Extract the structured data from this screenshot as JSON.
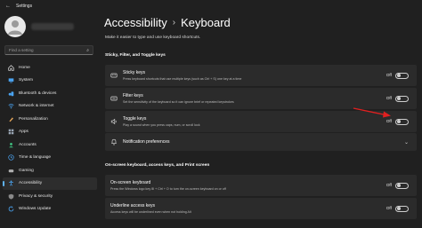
{
  "titlebar": {
    "title": "Settings",
    "back_icon": "back-arrow-icon"
  },
  "search": {
    "placeholder": "Find a setting"
  },
  "sidebar": {
    "items": [
      {
        "label": "Home",
        "icon": "home-icon",
        "color": "#e6e6e6"
      },
      {
        "label": "System",
        "icon": "system-icon",
        "color": "#4aa3f0"
      },
      {
        "label": "Bluetooth & devices",
        "icon": "bluetooth-icon",
        "color": "#4aa3f0"
      },
      {
        "label": "Network & internet",
        "icon": "network-icon",
        "color": "#4aa3f0"
      },
      {
        "label": "Personalization",
        "icon": "brush-icon",
        "color": "#e6a65a"
      },
      {
        "label": "Apps",
        "icon": "apps-icon",
        "color": "#9aa6b5"
      },
      {
        "label": "Accounts",
        "icon": "accounts-icon",
        "color": "#3fbf7f"
      },
      {
        "label": "Time & language",
        "icon": "time-language-icon",
        "color": "#4aa3f0"
      },
      {
        "label": "Gaming",
        "icon": "gaming-icon",
        "color": "#b0b0b0"
      },
      {
        "label": "Accessibility",
        "icon": "accessibility-icon",
        "color": "#4aa3f0",
        "active": true
      },
      {
        "label": "Privacy & security",
        "icon": "shield-icon",
        "color": "#8a8a8a"
      },
      {
        "label": "Windows Update",
        "icon": "windows-update-icon",
        "color": "#4aa3f0"
      }
    ]
  },
  "main": {
    "breadcrumb_parent": "Accessibility",
    "breadcrumb_current": "Keyboard",
    "subtitle": "Make it easier to type and use keyboard shortcuts.",
    "section1": "Sticky, Filter, and Toggle keys",
    "section2": "On-screen keyboard, access keys, and Print screen",
    "cards": [
      {
        "title": "Sticky keys",
        "desc": "Press keyboard shortcuts that use multiple keys (such as Ctrl + S) one key at a time",
        "state": "Off",
        "icon": "sticky-keys-icon"
      },
      {
        "title": "Filter keys",
        "desc": "Set the sensitivity of the keyboard so it can ignore brief or repeated keystrokes",
        "state": "Off",
        "icon": "filter-keys-icon"
      },
      {
        "title": "Toggle keys",
        "desc": "Play a sound when you press caps, num, or scroll lock",
        "state": "Off",
        "icon": "speaker-icon"
      },
      {
        "title": "Notification preferences",
        "icon": "bell-icon"
      },
      {
        "title": "On-screen keyboard",
        "desc": "Press the Windows logo key ⊞ + Ctrl + O to turn the on-screen keyboard on or off",
        "state": "Off",
        "icon": "keyboard-icon"
      },
      {
        "title": "Underline access keys",
        "desc": "Access keys will be underlined even when not holding Alt",
        "state": "Off",
        "icon": "underline-icon"
      }
    ]
  },
  "colors": {
    "accent": "#5fb2f2",
    "annotation_arrow": "#e02020"
  }
}
